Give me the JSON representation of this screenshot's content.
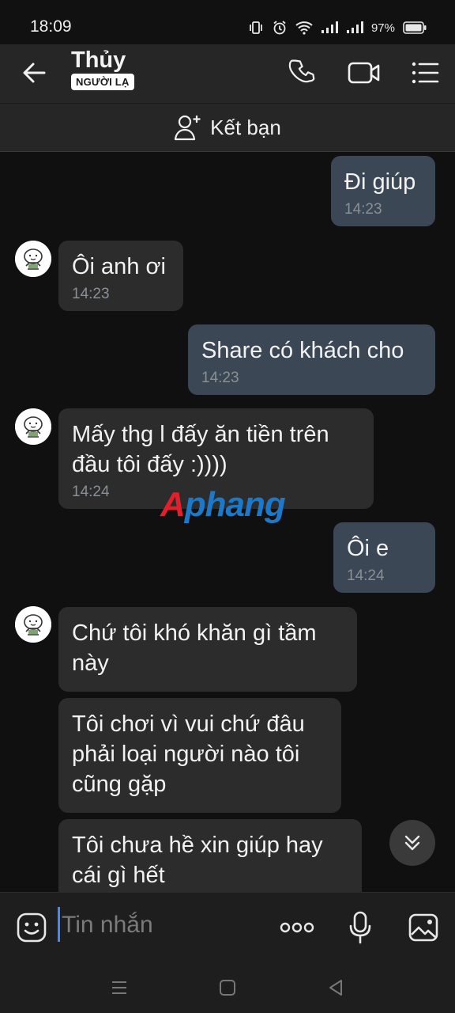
{
  "status_bar": {
    "time": "18:09",
    "battery": "97%"
  },
  "header": {
    "name": "Thủy",
    "badge": "NGƯỜI LẠ"
  },
  "friend_bar": {
    "label": "Kết bạn"
  },
  "messages": [
    {
      "direction": "out",
      "lines": [
        "Đi giúp"
      ],
      "time": "14:23"
    },
    {
      "direction": "in",
      "lines": [
        "Ôi anh ơi"
      ],
      "time": "14:23"
    },
    {
      "direction": "out",
      "lines": [
        "Share có khách cho"
      ],
      "time": "14:23"
    },
    {
      "direction": "in",
      "lines": [
        "Mấy thg l đấy ăn tiền trên",
        "đầu tôi đấy :))))"
      ],
      "time": "14:24"
    },
    {
      "direction": "out",
      "lines": [
        "Ôi e"
      ],
      "time": "14:24"
    },
    {
      "direction": "in",
      "lines": [
        "Chứ tôi khó khăn gì tầm",
        "này"
      ],
      "time": ""
    },
    {
      "direction": "in",
      "lines": [
        "Tôi chơi vì vui chứ đâu",
        "phải loại người nào tôi",
        "cũng gặp"
      ],
      "time": ""
    },
    {
      "direction": "in",
      "lines": [
        "Tôi chưa hề xin giúp hay",
        "cái gì hết"
      ],
      "time": ""
    }
  ],
  "watermark": {
    "part1": "A",
    "part2": "phang"
  },
  "input": {
    "placeholder": "Tin nhắn"
  },
  "icons": {
    "back": "arrow-left-icon",
    "call": "phone-icon",
    "video": "video-camera-icon",
    "menu": "list-menu-icon",
    "add_friend": "add-user-icon",
    "emoji": "emoji-icon",
    "more": "more-dots-icon",
    "mic": "microphone-icon",
    "image": "image-icon",
    "scroll_down": "double-chevron-down-icon"
  },
  "colors": {
    "outgoing_bubble": "#3b4754",
    "incoming_bubble": "#2c2c2c",
    "timestamp": "#8a8f96",
    "cursor": "#3d8bfd"
  }
}
